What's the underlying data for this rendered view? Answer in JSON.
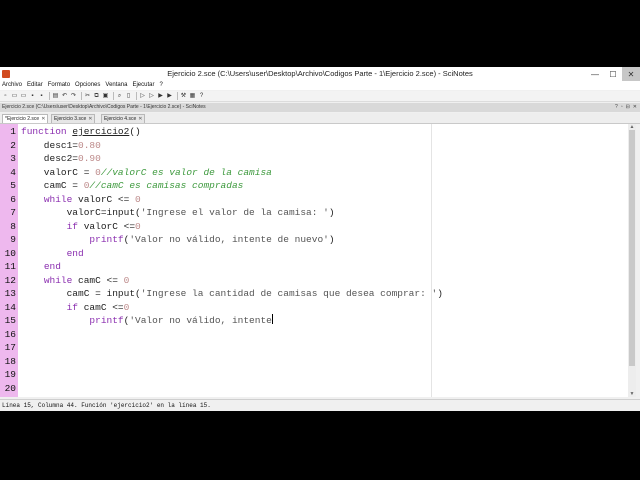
{
  "window": {
    "title": "Ejercicio 2.sce (C:\\Users\\user\\Desktop\\Archivo\\Codigos Parte - 1\\Ejercicio 2.sce) - SciNotes",
    "minimize": "—",
    "maximize": "☐",
    "close": "✕"
  },
  "menubar": {
    "items": [
      "Archivo",
      "Editar",
      "Formato",
      "Opciones",
      "Ventana",
      "Ejecutar",
      "?"
    ]
  },
  "panel": {
    "title": "Ejercicio 2.sce (C:\\Users\\user\\Desktop\\Archivo\\Codigos Parte - 1\\Ejercicio 2.sce) - SciNotes",
    "buttons": [
      "?",
      "▫",
      "⊟",
      "✕"
    ]
  },
  "tabs": [
    {
      "label": "*Ejercicio 2.sce",
      "active": true
    },
    {
      "label": "Ejercicio 3.sce",
      "active": false
    },
    {
      "label": "Ejercicio 4.sce",
      "active": false
    }
  ],
  "editor": {
    "line_numbers": [
      "1",
      "2",
      "3",
      "4",
      "5",
      "6",
      "7",
      "8",
      "9",
      "10",
      "11",
      "12",
      "13",
      "14",
      "15",
      "16",
      "17",
      "18",
      "19",
      "20"
    ],
    "lines": [
      [
        {
          "t": "function",
          "c": "key"
        },
        {
          "t": " "
        },
        {
          "t": "ejercicio2",
          "c": "func"
        },
        {
          "t": "()"
        }
      ],
      [
        {
          "t": "    desc1="
        },
        {
          "t": "0.80",
          "c": "num"
        }
      ],
      [
        {
          "t": "    desc2="
        },
        {
          "t": "0.90",
          "c": "num"
        }
      ],
      [
        {
          "t": "    valorC = "
        },
        {
          "t": "0",
          "c": "num"
        },
        {
          "t": "//valorC es valor de la camisa",
          "c": "com"
        }
      ],
      [
        {
          "t": "    camC = "
        },
        {
          "t": "0",
          "c": "num"
        },
        {
          "t": "//camC es camisas compradas",
          "c": "com"
        }
      ],
      [
        {
          "t": "    "
        },
        {
          "t": "while",
          "c": "key"
        },
        {
          "t": " valorC <= "
        },
        {
          "t": "0",
          "c": "num"
        }
      ],
      [
        {
          "t": "        valorC=input("
        },
        {
          "t": "'Ingrese el valor de la camisa: '",
          "c": "str"
        },
        {
          "t": ")"
        }
      ],
      [
        {
          "t": "        "
        },
        {
          "t": "if",
          "c": "key"
        },
        {
          "t": " valorC <="
        },
        {
          "t": "0",
          "c": "num"
        }
      ],
      [
        {
          "t": "            printf",
          "c": "key"
        },
        {
          "t": "("
        },
        {
          "t": "'Valor no válido, intente de nuevo'",
          "c": "str"
        },
        {
          "t": ")"
        }
      ],
      [
        {
          "t": "        "
        },
        {
          "t": "end",
          "c": "key"
        }
      ],
      [
        {
          "t": "    "
        },
        {
          "t": "end",
          "c": "key"
        }
      ],
      [
        {
          "t": "    "
        },
        {
          "t": "while",
          "c": "key"
        },
        {
          "t": " camC <= "
        },
        {
          "t": "0",
          "c": "num"
        }
      ],
      [
        {
          "t": "        camC = input("
        },
        {
          "t": "'Ingrese la cantidad de camisas que desea comprar: '",
          "c": "str"
        },
        {
          "t": ")"
        }
      ],
      [
        {
          "t": "        "
        },
        {
          "t": "if",
          "c": "key"
        },
        {
          "t": " camC <="
        },
        {
          "t": "0",
          "c": "num"
        }
      ],
      [
        {
          "t": "            printf",
          "c": "key"
        },
        {
          "t": "("
        },
        {
          "t": "'Valor no válido, intente",
          "c": "str"
        }
      ],
      [],
      [],
      [],
      [],
      []
    ],
    "cursor_line": 15
  },
  "statusbar": {
    "text": "Línea 15, Columna 44. Función 'ejercicio2' en la línea 15."
  },
  "colors": {
    "gutter": "#eeb8ee",
    "keyword": "#8b2fb0",
    "number": "#bd8a8a",
    "comment": "#3e9a3e"
  }
}
